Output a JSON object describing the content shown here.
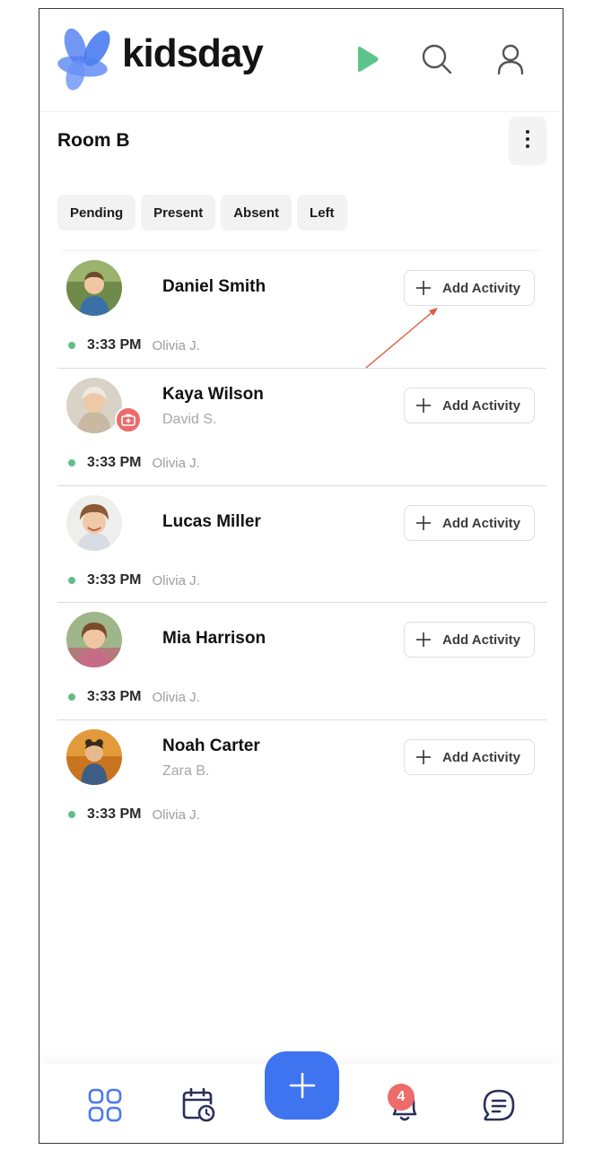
{
  "app": {
    "brand_name": "kidsday",
    "brand_color": "#3f74f0",
    "play_icon": "play-icon",
    "search_icon": "search-icon",
    "profile_icon": "user-icon"
  },
  "room": {
    "title": "Room B",
    "more_icon": "vertical-ellipsis-icon"
  },
  "filters": [
    {
      "label": "Pending"
    },
    {
      "label": "Present"
    },
    {
      "label": "Absent"
    },
    {
      "label": "Left"
    }
  ],
  "children": [
    {
      "name": "Daniel Smith",
      "sub": "",
      "action": "Add Activity",
      "time": "3:33 PM",
      "staff": "Olivia J.",
      "medical": false
    },
    {
      "name": "Kaya Wilson",
      "sub": "David S.",
      "action": "Add Activity",
      "time": "3:33 PM",
      "staff": "Olivia J.",
      "medical": true
    },
    {
      "name": "Lucas Miller",
      "sub": "",
      "action": "Add Activity",
      "time": "3:33 PM",
      "staff": "Olivia J.",
      "medical": false
    },
    {
      "name": "Mia Harrison",
      "sub": "",
      "action": "Add Activity",
      "time": "3:33 PM",
      "staff": "Olivia J.",
      "medical": false
    },
    {
      "name": "Noah Carter",
      "sub": "Zara B.",
      "action": "Add Activity",
      "time": "3:33 PM",
      "staff": "Olivia J.",
      "medical": false
    }
  ],
  "status_color": "#5fbf8b",
  "bottom_nav": {
    "items": [
      {
        "icon": "grid-icon"
      },
      {
        "icon": "calendar-clock-icon"
      },
      {
        "icon": "plus-icon"
      },
      {
        "icon": "bell-icon",
        "badge": "4"
      },
      {
        "icon": "chat-icon"
      }
    ]
  }
}
